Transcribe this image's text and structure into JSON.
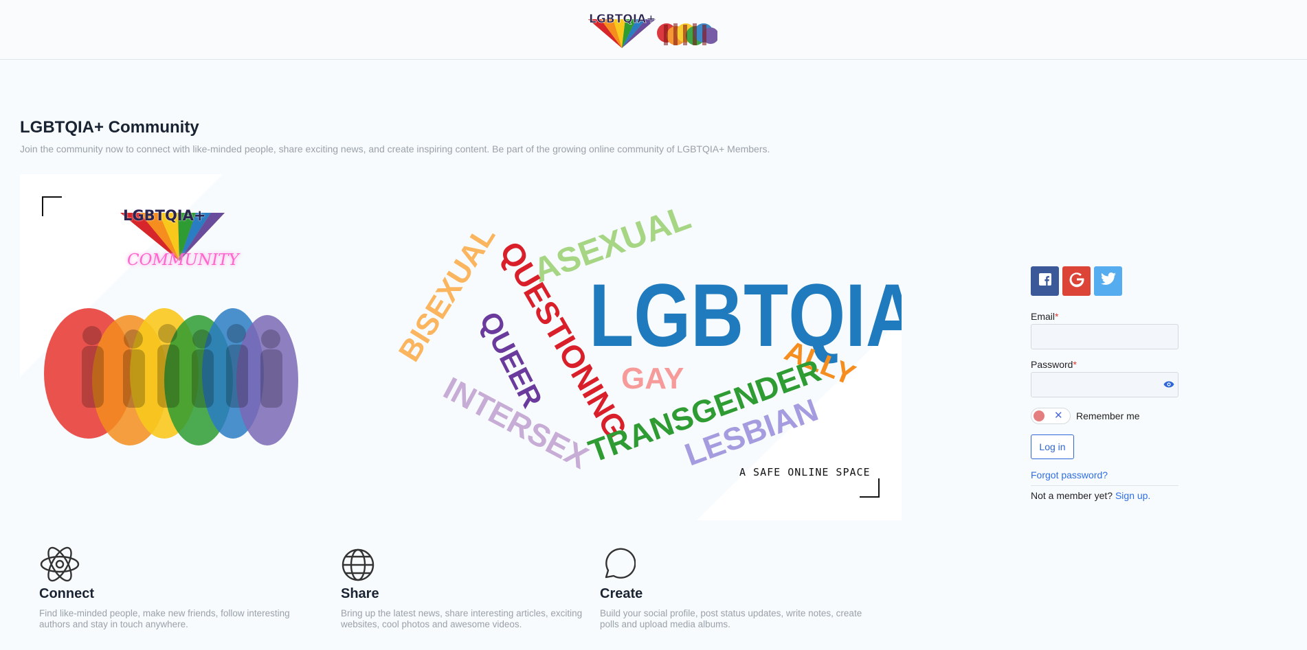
{
  "header": {
    "logo_text": "LGBTQIA+",
    "logo_icon": "rainbow-triangle-logo"
  },
  "intro": {
    "title": "LGBTQIA+ Community",
    "subtitle": "Join the community now to connect with like-minded people, share exciting news, and create inspiring content. Be part of the growing online community of LGBTQIA+ Members."
  },
  "hero": {
    "badge_top": "LGBTQIA+",
    "badge_bottom": "COMMUNITY",
    "word_cloud": [
      "LGBTQIA",
      "ASEXUAL",
      "QUESTIONING",
      "BISEXUAL",
      "QUEER",
      "GAY",
      "ALLY",
      "TRANSGENDER",
      "LESBIAN",
      "INTERSEX"
    ],
    "caption": "A SAFE ONLINE SPACE",
    "colors": {
      "red": "#d7262b",
      "orange": "#f58d1f",
      "yellow": "#f8c81d",
      "green": "#2e9b33",
      "blue": "#2a7dc3",
      "purple": "#6a4c9c"
    }
  },
  "login": {
    "social": [
      {
        "icon": "facebook-icon",
        "color": "#3b5998"
      },
      {
        "icon": "google-icon",
        "color": "#db4437"
      },
      {
        "icon": "twitter-icon",
        "color": "#55acee"
      }
    ],
    "email_label": "Email",
    "email_value": "",
    "password_label": "Password",
    "password_value": "",
    "required_mark": "*",
    "remember_label": "Remember me",
    "remember_checked": false,
    "login_button": "Log in",
    "forgot_link": "Forgot password?",
    "not_member_text": "Not a member yet?",
    "signup_link": "Sign up."
  },
  "features": [
    {
      "icon": "atom-icon",
      "name": "Connect",
      "desc": "Find like-minded people, make new friends, follow interesting authors and stay in touch anywhere."
    },
    {
      "icon": "globe-icon",
      "name": "Share",
      "desc": "Bring up the latest news, share interesting articles, exciting websites, cool photos and awesome videos."
    },
    {
      "icon": "chat-bubble-icon",
      "name": "Create",
      "desc": "Build your social profile, post status updates, write notes, create polls and upload media albums."
    }
  ]
}
